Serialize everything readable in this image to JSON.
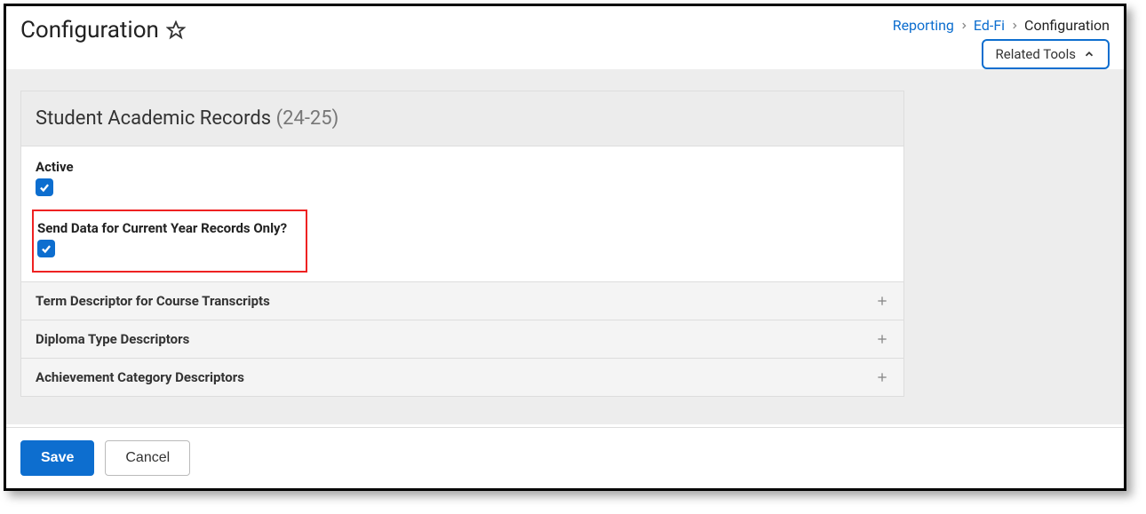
{
  "header": {
    "title": "Configuration",
    "breadcrumb": {
      "items": [
        "Reporting",
        "Ed-Fi",
        "Configuration"
      ]
    },
    "related_tools_label": "Related Tools"
  },
  "panel": {
    "title": "Student Academic Records",
    "year": "(24-25)",
    "fields": {
      "active": {
        "label": "Active",
        "checked": true
      },
      "current_year_only": {
        "label": "Send Data for Current Year Records Only?",
        "checked": true
      }
    },
    "expand_rows": [
      {
        "label": "Term Descriptor for Course Transcripts"
      },
      {
        "label": "Diploma Type Descriptors"
      },
      {
        "label": "Achievement Category Descriptors"
      }
    ]
  },
  "footer": {
    "save_label": "Save",
    "cancel_label": "Cancel"
  }
}
